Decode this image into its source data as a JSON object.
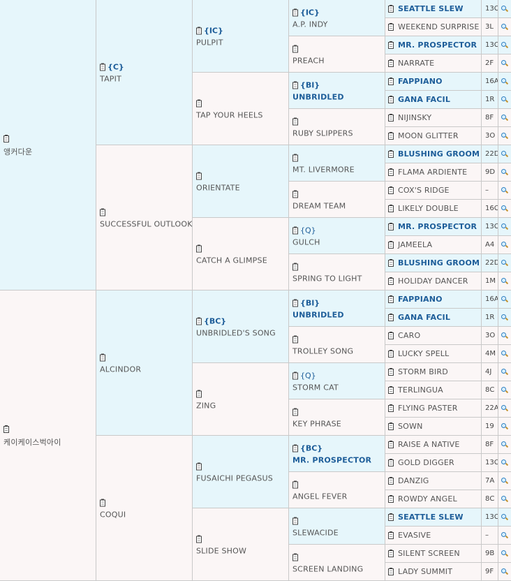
{
  "pedigree": {
    "g1": [
      {
        "name": "앵커다운",
        "code": ""
      },
      {
        "name": "케이케이스벅아이",
        "code": ""
      }
    ],
    "g2": [
      {
        "name": "TAPIT",
        "code": "{C}"
      },
      {
        "name": "SUCCESSFUL OUTLOOK",
        "code": ""
      },
      {
        "name": "ALCINDOR",
        "code": ""
      },
      {
        "name": "COQUI",
        "code": ""
      }
    ],
    "g3": [
      {
        "name": "PULPIT",
        "code": "{IC}"
      },
      {
        "name": "TAP YOUR HEELS",
        "code": ""
      },
      {
        "name": "ORIENTATE",
        "code": ""
      },
      {
        "name": "CATCH A GLIMPSE",
        "code": ""
      },
      {
        "name": "UNBRIDLED'S SONG",
        "code": "{BC}"
      },
      {
        "name": "ZING",
        "code": ""
      },
      {
        "name": "FUSAICHI PEGASUS",
        "code": ""
      },
      {
        "name": "SLIDE SHOW",
        "code": ""
      }
    ],
    "g4": [
      {
        "name": "A.P. INDY",
        "code": "{IC}",
        "bold": false
      },
      {
        "name": "PREACH",
        "code": "",
        "bold": false
      },
      {
        "name": "UNBRIDLED",
        "code": "{BI}",
        "bold": true
      },
      {
        "name": "RUBY SLIPPERS",
        "code": "",
        "bold": false
      },
      {
        "name": "MT. LIVERMORE",
        "code": "",
        "bold": false
      },
      {
        "name": "DREAM TEAM",
        "code": "",
        "bold": false
      },
      {
        "name": "GULCH",
        "code": "{Q}",
        "bold": false
      },
      {
        "name": "SPRING TO LIGHT",
        "code": "",
        "bold": false
      },
      {
        "name": "UNBRIDLED",
        "code": "{BI}",
        "bold": true
      },
      {
        "name": "TROLLEY SONG",
        "code": "",
        "bold": false
      },
      {
        "name": "STORM CAT",
        "code": "{Q}",
        "bold": false
      },
      {
        "name": "KEY PHRASE",
        "code": "",
        "bold": false
      },
      {
        "name": "MR. PROSPECTOR",
        "code": "{BC}",
        "bold": true
      },
      {
        "name": "ANGEL FEVER",
        "code": "",
        "bold": false
      },
      {
        "name": "SLEWACIDE",
        "code": "",
        "bold": false
      },
      {
        "name": "SCREEN LANDING",
        "code": "",
        "bold": false
      }
    ],
    "g5": [
      {
        "name": "SEATTLE SLEW",
        "bold": true,
        "rating": "13C"
      },
      {
        "name": "WEEKEND SURPRISE",
        "bold": false,
        "rating": "3L"
      },
      {
        "name": "MR. PROSPECTOR",
        "bold": true,
        "rating": "13C"
      },
      {
        "name": "NARRATE",
        "bold": false,
        "rating": "2F"
      },
      {
        "name": "FAPPIANO",
        "bold": true,
        "rating": "16A"
      },
      {
        "name": "GANA FACIL",
        "bold": true,
        "rating": "1R"
      },
      {
        "name": "NIJINSKY",
        "bold": false,
        "rating": "8F"
      },
      {
        "name": "MOON GLITTER",
        "bold": false,
        "rating": "3O"
      },
      {
        "name": "BLUSHING GROOM",
        "bold": true,
        "rating": "22D"
      },
      {
        "name": "FLAMA ARDIENTE",
        "bold": false,
        "rating": "9D"
      },
      {
        "name": "COX'S RIDGE",
        "bold": false,
        "rating": "–"
      },
      {
        "name": "LIKELY DOUBLE",
        "bold": false,
        "rating": "16C"
      },
      {
        "name": "MR. PROSPECTOR",
        "bold": true,
        "rating": "13C"
      },
      {
        "name": "JAMEELA",
        "bold": false,
        "rating": "A4"
      },
      {
        "name": "BLUSHING GROOM",
        "bold": true,
        "rating": "22D"
      },
      {
        "name": "HOLIDAY DANCER",
        "bold": false,
        "rating": "1M"
      },
      {
        "name": "FAPPIANO",
        "bold": true,
        "rating": "16A"
      },
      {
        "name": "GANA FACIL",
        "bold": true,
        "rating": "1R"
      },
      {
        "name": "CARO",
        "bold": false,
        "rating": "3O"
      },
      {
        "name": "LUCKY SPELL",
        "bold": false,
        "rating": "4M"
      },
      {
        "name": "STORM BIRD",
        "bold": false,
        "rating": "4J"
      },
      {
        "name": "TERLINGUA",
        "bold": false,
        "rating": "8C"
      },
      {
        "name": "FLYING PASTER",
        "bold": false,
        "rating": "22A"
      },
      {
        "name": "SOWN",
        "bold": false,
        "rating": "19"
      },
      {
        "name": "RAISE A NATIVE",
        "bold": false,
        "rating": "8F"
      },
      {
        "name": "GOLD DIGGER",
        "bold": false,
        "rating": "13C"
      },
      {
        "name": "DANZIG",
        "bold": false,
        "rating": "7A"
      },
      {
        "name": "ROWDY ANGEL",
        "bold": false,
        "rating": "8C"
      },
      {
        "name": "SEATTLE SLEW",
        "bold": true,
        "rating": "13C"
      },
      {
        "name": "EVASIVE",
        "bold": false,
        "rating": "–"
      },
      {
        "name": "SILENT SCREEN",
        "bold": false,
        "rating": "9B"
      },
      {
        "name": "LADY SUMMIT",
        "bold": false,
        "rating": "9F"
      }
    ],
    "icons": {
      "pedigree": "clipboard-icon",
      "search": "magnifier-icon"
    },
    "colors": {
      "cell_blue": "#e6f6fb",
      "cell_pink": "#fbf6f6",
      "link_blue": "#1d5d99"
    }
  }
}
